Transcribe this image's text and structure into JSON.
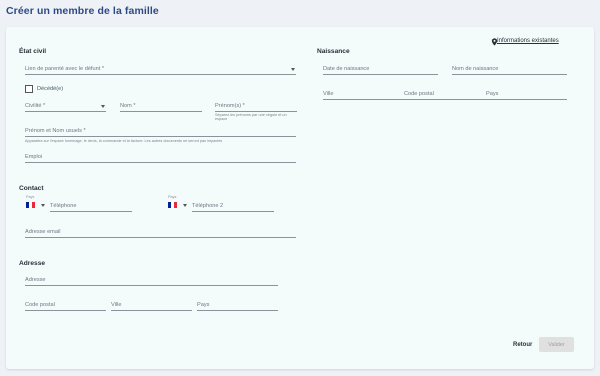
{
  "page": {
    "title": "Créer un membre de la famille"
  },
  "etat_civil": {
    "title": "État civil",
    "lien_parente": {
      "label": "Lien de parenté avec le défunt *"
    },
    "decede": {
      "label": "Décédé(e)"
    },
    "civilite": {
      "label": "Civilité *"
    },
    "nom": {
      "label": "Nom *"
    },
    "prenoms": {
      "label": "Prénom(s) *",
      "hint": "Séparez les prénoms par une virgule et un espace"
    },
    "prenom_nom_usuels": {
      "label": "Prénom et Nom usuels *",
      "hint": "Apparaitra sur l'espace hommage, le devis, la commande et la facture. Les autres documents ne seront pas impactés"
    },
    "emploi": {
      "label": "Emploi"
    }
  },
  "naissance": {
    "title": "Naissance",
    "info_link": "Informations existantes",
    "date": {
      "label": "Date de naissance"
    },
    "nom": {
      "label": "Nom de naissance"
    },
    "ville": {
      "label": "Ville"
    },
    "code_postal": {
      "label": "Code postal"
    },
    "pays": {
      "label": "Pays"
    }
  },
  "contact": {
    "title": "Contact",
    "country_label": "Pays",
    "telephone": {
      "label": "Téléphone"
    },
    "country_label_2": "Pays",
    "telephone2": {
      "label": "Téléphone 2"
    },
    "email": {
      "label": "Adresse email"
    }
  },
  "adresse": {
    "title": "Adresse",
    "adresse": {
      "label": "Adresse"
    },
    "code_postal": {
      "label": "Code postal"
    },
    "ville": {
      "label": "Ville"
    },
    "pays": {
      "label": "Pays"
    }
  },
  "actions": {
    "retour": "Retour",
    "valider": "Valider"
  },
  "colors": {
    "title": "#2e4a86",
    "flag_blue": "#002395",
    "flag_white": "#ffffff",
    "flag_red": "#ed2939"
  },
  "icons": {
    "info": "map-pin-icon",
    "dropdown": "caret-down-icon",
    "country": "france-flag-icon"
  }
}
